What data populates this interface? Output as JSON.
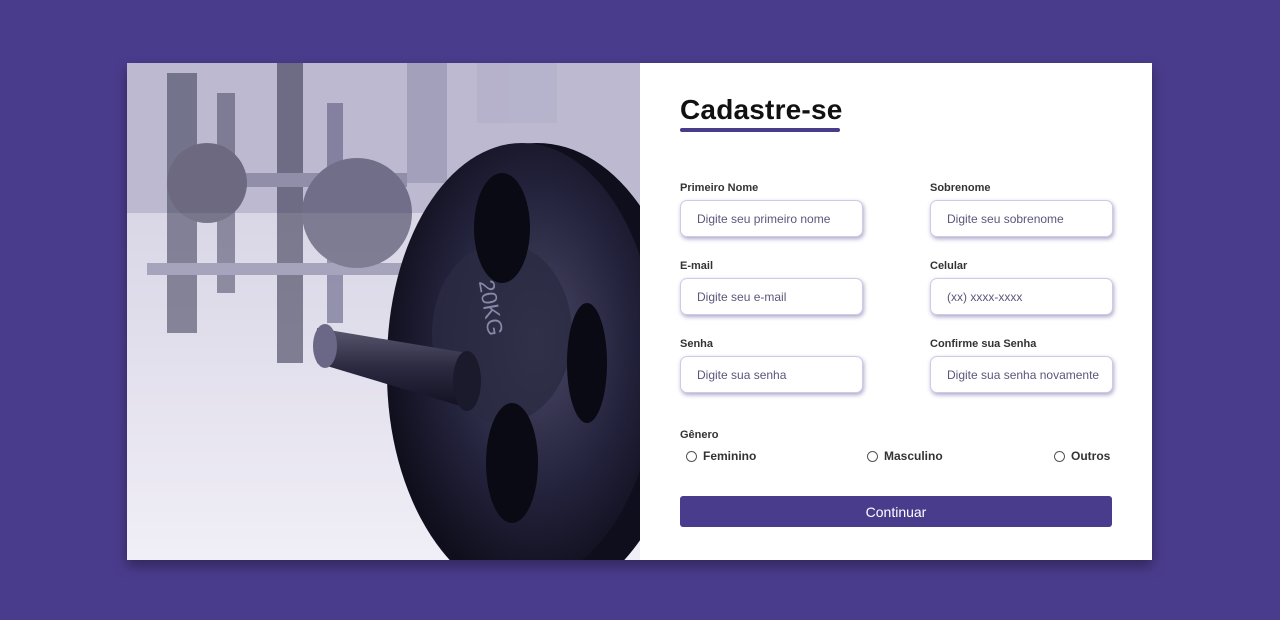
{
  "hero": {
    "image_description": "gym-weight-plate-photo"
  },
  "form": {
    "title": "Cadastre-se",
    "fields": {
      "first_name": {
        "label": "Primeiro Nome",
        "placeholder": "Digite seu primeiro nome"
      },
      "last_name": {
        "label": "Sobrenome",
        "placeholder": "Digite seu sobrenome"
      },
      "email": {
        "label": "E-mail",
        "placeholder": "Digite seu e-mail"
      },
      "phone": {
        "label": "Celular",
        "placeholder": "(xx) xxxx-xxxx"
      },
      "password": {
        "label": "Senha",
        "placeholder": "Digite sua senha"
      },
      "confirm_password": {
        "label": "Confirme sua Senha",
        "placeholder": "Digite sua senha novamente"
      }
    },
    "gender": {
      "label": "Gênero",
      "options": [
        "Feminino",
        "Masculino",
        "Outros"
      ]
    },
    "submit_label": "Continuar"
  },
  "colors": {
    "background": "#4a3c8c",
    "accent": "#4a3c8c",
    "card": "#ffffff"
  }
}
